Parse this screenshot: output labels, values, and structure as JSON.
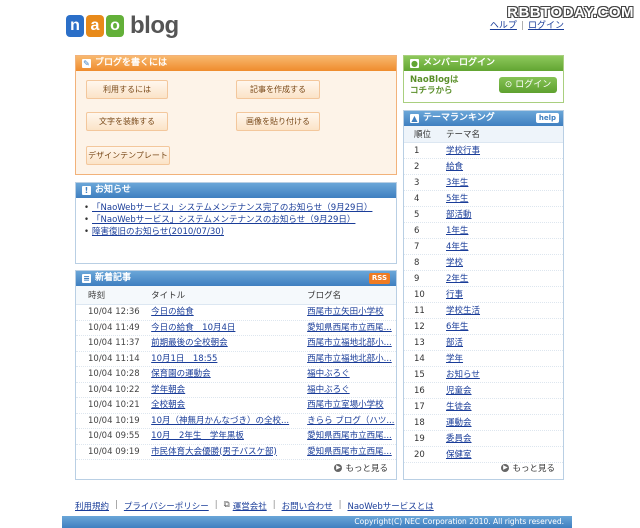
{
  "watermark": "RBBTODAY.COM",
  "header": {
    "logo_letters": [
      "n",
      "a",
      "o"
    ],
    "logo_word": "blog",
    "help_link": "ヘルプ",
    "separator": "|",
    "login_link": "ログイン"
  },
  "write": {
    "title": "ブログを書くには",
    "buttons": {
      "how_to_use": "利用するには",
      "create_post": "記事を作成する",
      "decorate_text": "文字を装飾する",
      "paste_image": "画像を貼り付ける",
      "design_template": "デザインテンプレート"
    }
  },
  "news": {
    "title": "お知らせ",
    "items": [
      "「NaoWebサービス」システムメンテナンス完了のお知らせ（9月29日）",
      "「NaoWebサービス」システムメンテナンスのお知らせ（9月29日）",
      "障害復旧のお知らせ(2010/07/30)"
    ]
  },
  "new_posts": {
    "title": "新着記事",
    "rss": "RSS",
    "columns": {
      "time": "時刻",
      "title": "タイトル",
      "blog": "ブログ名"
    },
    "rows": [
      {
        "time": "10/04 12:36",
        "title": "今日の給食",
        "blog": "西尾市立矢田小学校"
      },
      {
        "time": "10/04 11:49",
        "title": "今日の給食　10月4日",
        "blog": "愛知県西尾市立西尾..."
      },
      {
        "time": "10/04 11:37",
        "title": "前期最後の全校朝会",
        "blog": "西尾市立福地北部小..."
      },
      {
        "time": "10/04 11:14",
        "title": "10月1日　18:55",
        "blog": "西尾市立福地北部小..."
      },
      {
        "time": "10/04 10:28",
        "title": "保育園の運動会",
        "blog": "福中ぶろぐ"
      },
      {
        "time": "10/04 10:22",
        "title": "学年朝会",
        "blog": "福中ぶろぐ"
      },
      {
        "time": "10/04 10:21",
        "title": "全校朝会",
        "blog": "西尾市立室場小学校"
      },
      {
        "time": "10/04 10:19",
        "title": "10月（神無月かんなづき）の全校...",
        "blog": "きらら ブログ（ハツ..."
      },
      {
        "time": "10/04 09:55",
        "title": "10月　2年生　学年黒板",
        "blog": "愛知県西尾市立西尾..."
      },
      {
        "time": "10/04 09:19",
        "title": "市民体育大会優勝(男子バスケ部)",
        "blog": "愛知県西尾市立西尾..."
      }
    ],
    "more": "もっと見る"
  },
  "login": {
    "title": "メンバーログイン",
    "text_line1": "NaoBlogは",
    "text_line2": "コチラから",
    "button": "ログイン"
  },
  "ranking": {
    "title": "テーマランキング",
    "help": "help",
    "columns": {
      "rank": "順位",
      "name": "テーマ名"
    },
    "items": [
      {
        "rank": "1",
        "name": "学校行事"
      },
      {
        "rank": "2",
        "name": "給食"
      },
      {
        "rank": "3",
        "name": "3年生"
      },
      {
        "rank": "4",
        "name": "5年生"
      },
      {
        "rank": "5",
        "name": "部活動"
      },
      {
        "rank": "6",
        "name": "1年生"
      },
      {
        "rank": "7",
        "name": "4年生"
      },
      {
        "rank": "8",
        "name": "学校"
      },
      {
        "rank": "9",
        "name": "2年生"
      },
      {
        "rank": "10",
        "name": "行事"
      },
      {
        "rank": "11",
        "name": "学校生活"
      },
      {
        "rank": "12",
        "name": "6年生"
      },
      {
        "rank": "13",
        "name": "部活"
      },
      {
        "rank": "14",
        "name": "学年"
      },
      {
        "rank": "15",
        "name": "お知らせ"
      },
      {
        "rank": "16",
        "name": "児童会"
      },
      {
        "rank": "17",
        "name": "生徒会"
      },
      {
        "rank": "18",
        "name": "運動会"
      },
      {
        "rank": "19",
        "name": "委員会"
      },
      {
        "rank": "20",
        "name": "保健室"
      }
    ],
    "more": "もっと見る"
  },
  "footer": {
    "links": [
      "利用規約",
      "プライバシーポリシー",
      "運営会社",
      "お問い合わせ",
      "NaoWebサービスとは"
    ],
    "separator": "|",
    "copyright": "Copyright(C) NEC Corporation 2010. All rights reserved."
  }
}
